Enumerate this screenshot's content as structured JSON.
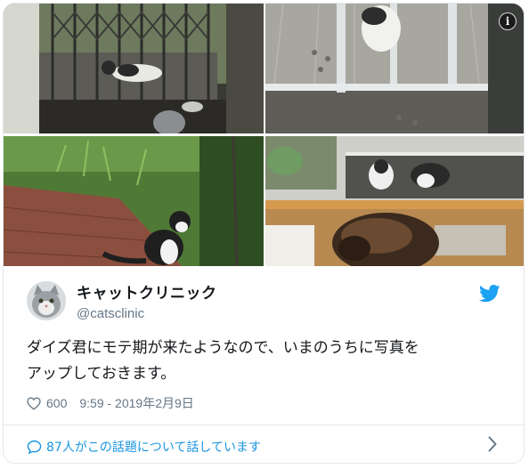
{
  "tweet": {
    "display_name": "キャットクリニック",
    "handle": "@catsclinic",
    "text": "ダイズ君にモテ期が来たようなので、いまのうちに写真を\nアップしておきます。",
    "like_count": "600",
    "timestamp": "9:59 - 2019年2月9日",
    "conversation_link": "87人がこの話題について話しています"
  },
  "icons": {
    "info": "info-icon",
    "bird": "twitter-bird-icon",
    "heart": "heart-icon",
    "reply_bubble": "speech-bubble-icon",
    "chevron": "chevron-right-icon"
  },
  "colors": {
    "brand_blue": "#1da1f2",
    "link_blue": "#1b95e0",
    "secondary_text": "#657786",
    "border": "#e1e8ed"
  },
  "media": {
    "photo_count": 4,
    "info_glyph": "i"
  }
}
